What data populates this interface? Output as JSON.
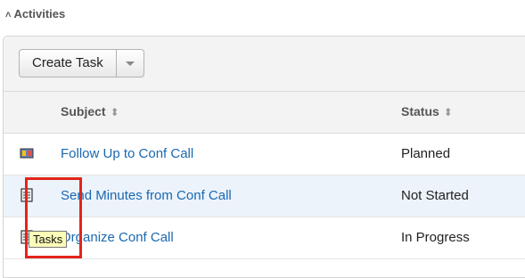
{
  "section": {
    "title": "Activities"
  },
  "toolbar": {
    "create_task_label": "Create Task"
  },
  "columns": {
    "subject": "Subject",
    "status": "Status"
  },
  "rows": [
    {
      "subject": "Follow Up to Conf Call",
      "status": "Planned",
      "icon": "meeting-icon"
    },
    {
      "subject": "Send Minutes from Conf Call",
      "status": "Not Started",
      "icon": "task-icon"
    },
    {
      "subject": "Organize Conf Call",
      "status": "In Progress",
      "icon": "task-icon"
    }
  ],
  "tooltip": {
    "text": "Tasks"
  },
  "colors": {
    "link": "#1a68b0",
    "highlight": "#e3241a",
    "tooltip_bg": "#fdfdb8",
    "alt_row": "#ecf3fb"
  }
}
